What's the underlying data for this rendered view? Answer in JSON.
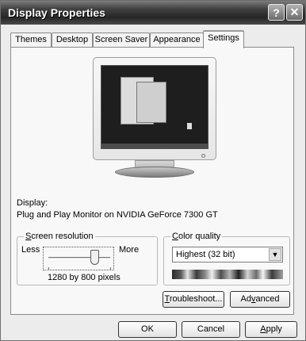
{
  "window": {
    "title": "Display Properties",
    "help_label": "?",
    "close_label": "✕"
  },
  "tabs": [
    {
      "label": "Themes"
    },
    {
      "label": "Desktop"
    },
    {
      "label": "Screen Saver"
    },
    {
      "label": "Appearance"
    },
    {
      "label": "Settings",
      "active": true
    }
  ],
  "display": {
    "label": "Display:",
    "value": "Plug and Play Monitor on NVIDIA GeForce 7300 GT"
  },
  "resolution": {
    "legend_underlined": "S",
    "legend_rest": "creen resolution",
    "less_label": "Less",
    "more_label": "More",
    "value_label": "1280 by 800 pixels",
    "slider_level": 0.75
  },
  "color_quality": {
    "legend_underlined": "C",
    "legend_rest": "olor quality",
    "selected": "Highest (32 bit)"
  },
  "buttons": {
    "troubleshoot_underlined": "T",
    "troubleshoot_rest": "roubleshoot...",
    "advanced_pre": "Ad",
    "advanced_underlined": "v",
    "advanced_rest": "anced",
    "ok": "OK",
    "cancel": "Cancel",
    "apply_underlined": "A",
    "apply_rest": "pply"
  }
}
